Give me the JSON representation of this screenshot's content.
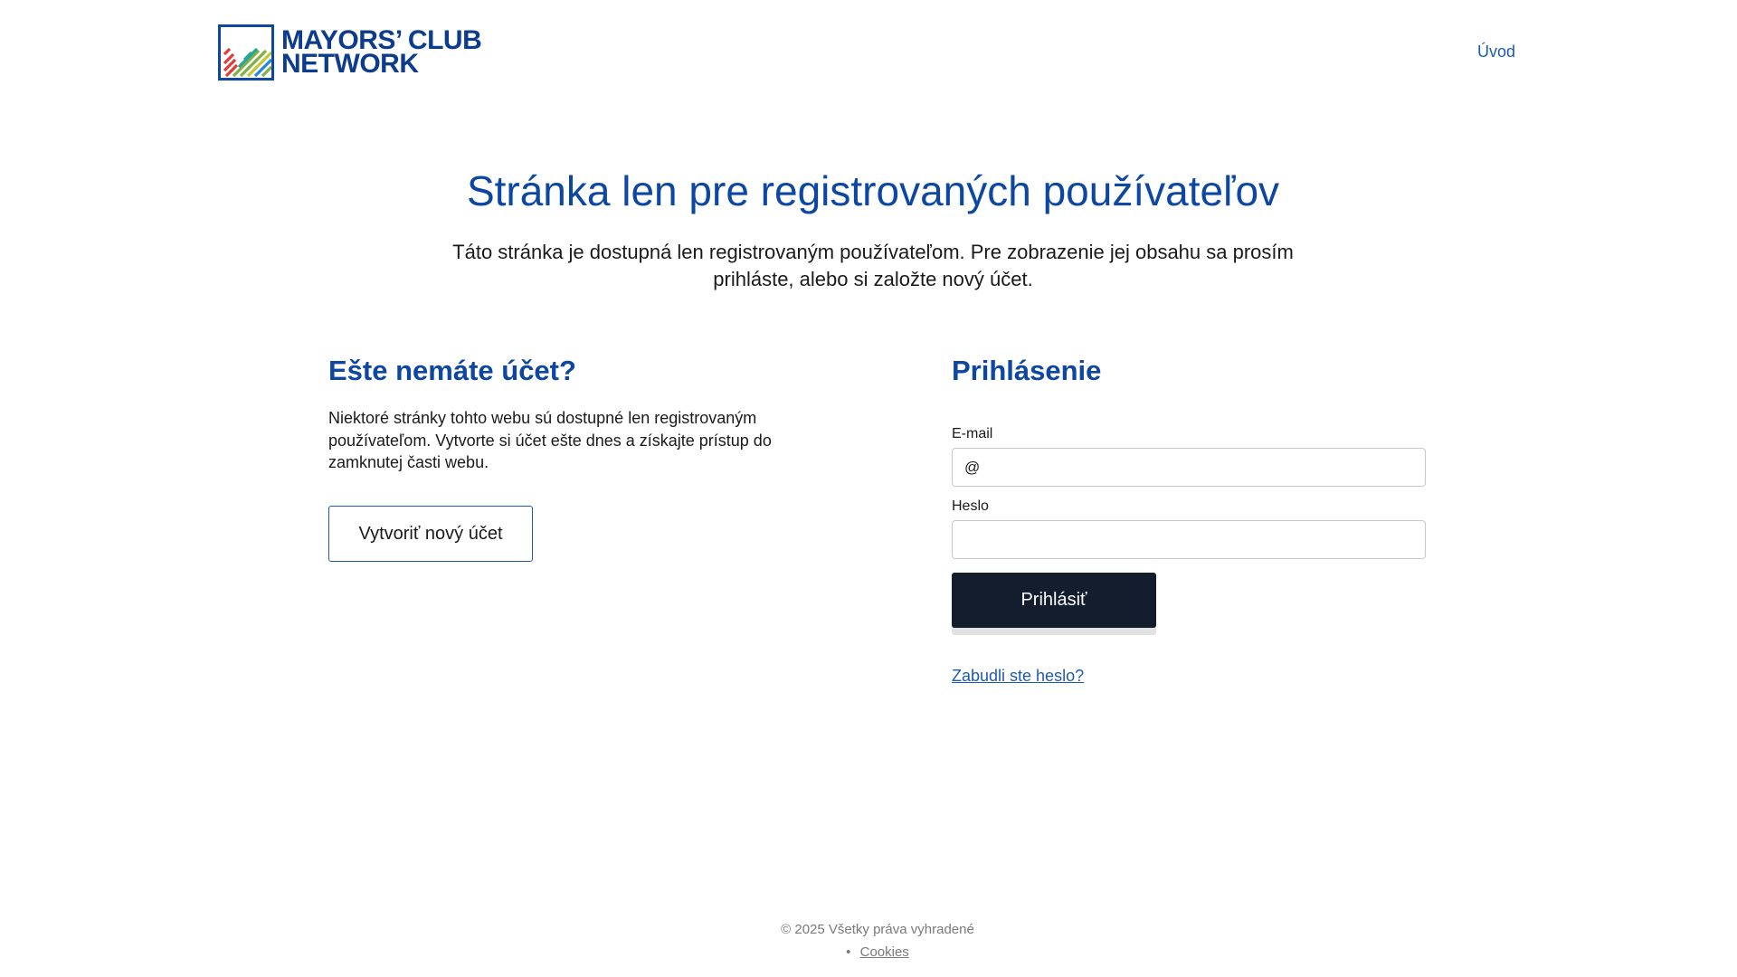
{
  "header": {
    "logo_line1": "MAYORS’ CLUB",
    "logo_line2": "NETWORK",
    "nav_home": "Úvod"
  },
  "hero": {
    "title": "Stránka len pre registrovaných používateľov",
    "text": "Táto stránka je dostupná len registrovaným používateľom. Pre zobrazenie jej obsahu sa prosím prihláste, alebo si založte nový účet."
  },
  "register": {
    "title": "Ešte nemáte účet?",
    "text": "Niektoré stránky tohto webu sú dostupné len registrovaným používateľom. Vytvorte si účet ešte dnes a získajte prístup do zamknutej časti webu.",
    "button_label": "Vytvoriť nový účet"
  },
  "login": {
    "title": "Prihlásenie",
    "email_label": "E-mail",
    "email_placeholder": "@",
    "password_label": "Heslo",
    "password_placeholder": "",
    "submit_label": "Prihlásiť",
    "forgot_link": "Zabudli ste heslo?"
  },
  "footer": {
    "copyright": "© 2025 Všetky práva vyhradené",
    "bullet": "•",
    "cookies_link": "Cookies"
  },
  "colors": {
    "brand_blue": "#0d47a1",
    "link_blue": "#1e5bb0",
    "button_dark": "#141d2e",
    "logo_red": "#e53935",
    "logo_green": "#7cb342"
  }
}
